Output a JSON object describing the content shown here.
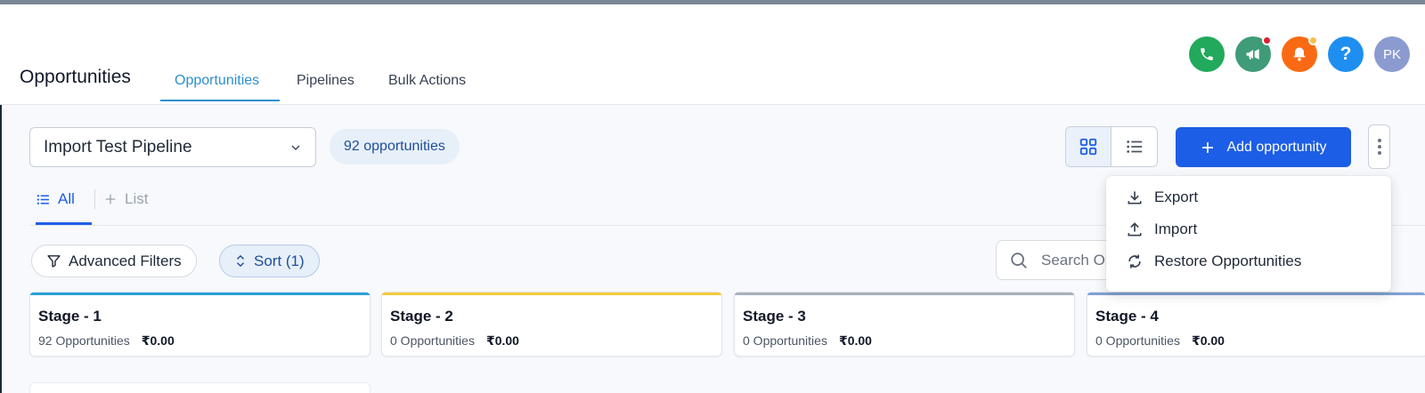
{
  "header": {
    "title": "Opportunities",
    "tabs": [
      {
        "label": "Opportunities",
        "active": true
      },
      {
        "label": "Pipelines",
        "active": false
      },
      {
        "label": "Bulk Actions",
        "active": false
      }
    ],
    "icons": [
      {
        "name": "phone-icon",
        "color": "#22a95b"
      },
      {
        "name": "megaphone-icon",
        "color": "#3f9b78",
        "badge": "#e11d2e"
      },
      {
        "name": "bell-icon",
        "color": "#fa6a14",
        "badge": "#f6c04a"
      },
      {
        "name": "help-icon",
        "color": "#1e8ff0"
      }
    ],
    "avatar_initials": "PK"
  },
  "toolbar": {
    "pipeline_value": "Import Test Pipeline",
    "count_label": "92 opportunities",
    "add_label": "Add opportunity"
  },
  "subtabs": {
    "all_label": "All",
    "list_label": "List"
  },
  "filters": {
    "advanced_label": "Advanced Filters",
    "sort_label": "Sort (1)",
    "search_placeholder": "Search Opportunities"
  },
  "menu": {
    "items": [
      {
        "label": "Export",
        "icon": "download-icon"
      },
      {
        "label": "Import",
        "icon": "upload-icon"
      },
      {
        "label": "Restore Opportunities",
        "icon": "restore-icon"
      }
    ]
  },
  "stages": [
    {
      "name": "Stage - 1",
      "count": "92 Opportunities",
      "amount": "₹0.00",
      "color": "#2aa0d8"
    },
    {
      "name": "Stage - 2",
      "count": "0 Opportunities",
      "amount": "₹0.00",
      "color": "#f2cb3c"
    },
    {
      "name": "Stage - 3",
      "count": "0 Opportunities",
      "amount": "₹0.00",
      "color": "#a9b0bb"
    },
    {
      "name": "Stage - 4",
      "count": "0 Opportunities",
      "amount": "₹0.00",
      "color": "#7fa2d6"
    }
  ]
}
